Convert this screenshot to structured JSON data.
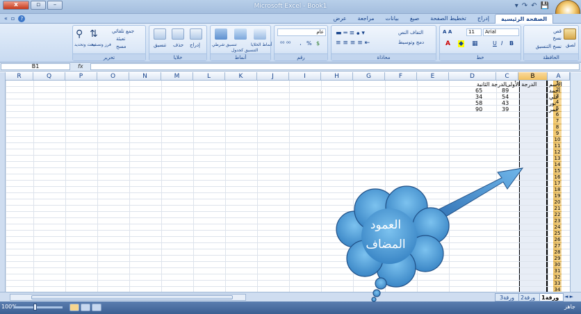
{
  "window": {
    "title": "Microsoft Excel - Book1",
    "close_label": "x",
    "restore_label": "▫",
    "minimize_label": "–"
  },
  "qat": {
    "save": "💾",
    "undo": "↶",
    "redo": "↷",
    "dropdown": "▾"
  },
  "tabs": [
    {
      "label": "الصفحة الرئيسية",
      "active": true
    },
    {
      "label": "إدراج"
    },
    {
      "label": "تخطيط الصفحة"
    },
    {
      "label": "صيغ"
    },
    {
      "label": "بيانات"
    },
    {
      "label": "مراجعة"
    },
    {
      "label": "عرض"
    }
  ],
  "ribbon": {
    "clipboard": {
      "title": "الحافظة",
      "paste": "لصق",
      "cut": "قص",
      "copy": "نسخ",
      "format_painter": "نسخ التنسيق"
    },
    "font": {
      "title": "خط",
      "font_name": "Arial",
      "font_size": "11",
      "bold": "B",
      "italic": "I",
      "underline": "U"
    },
    "alignment": {
      "title": "محاذاة",
      "wrap": "التفاف النص",
      "merge": "دمج وتوسيط"
    },
    "number": {
      "title": "رقم",
      "format": "عام",
      "percent": "%",
      "comma": "،",
      "currency": "$"
    },
    "styles": {
      "title": "أنماط",
      "conditional": "تنسيق شرطي",
      "as_table": "التنسيق كجدول",
      "cell_styles": "أنماط الخلايا"
    },
    "cells": {
      "title": "خلايا",
      "insert": "إدراج",
      "delete": "حذف",
      "format": "تنسيق"
    },
    "editing": {
      "title": "تحرير",
      "autosum": "جمع تلقائي",
      "fill": "تعبئة",
      "clear": "مسح",
      "sort": "فرز وتصفية",
      "find": "بحث وتحديد"
    }
  },
  "formula_bar": {
    "name_box": "B1",
    "fx": "fx",
    "value": ""
  },
  "columns": [
    "A",
    "B",
    "C",
    "D",
    "E",
    "F",
    "G",
    "H",
    "I",
    "J",
    "K",
    "L",
    "M",
    "N",
    "O",
    "P",
    "Q",
    "R"
  ],
  "selected_column": "B",
  "rows": [
    "1",
    "2",
    "3",
    "4",
    "5",
    "6",
    "7",
    "8",
    "9",
    "10",
    "11",
    "12",
    "13",
    "14",
    "15",
    "16",
    "17",
    "18",
    "19",
    "20",
    "21",
    "22",
    "23",
    "24",
    "25",
    "26",
    "27",
    "28",
    "29",
    "30",
    "31",
    "32",
    "33",
    "34",
    "35"
  ],
  "cells": {
    "A1": "الأسم",
    "C1": "الدرجة الثانية",
    "D1": "الدرجة الأولى",
    "A2": "أحمد",
    "C2": "89",
    "D2": "65",
    "A3": "علي",
    "C3": "54",
    "D3": "34",
    "A4": "نور",
    "C4": "43",
    "D4": "58",
    "A5": "عمر",
    "C5": "39",
    "D5": "90"
  },
  "callout": {
    "line1": "العمود",
    "line2": "المضاف",
    "color": "#4a9fd8"
  },
  "sheets": [
    {
      "label": "ورقة1",
      "active": true
    },
    {
      "label": "ورقة2"
    },
    {
      "label": "ورقة3"
    }
  ],
  "sheet_nav": "◄ ►",
  "status": {
    "ready": "جاهز",
    "zoom": "100%"
  }
}
